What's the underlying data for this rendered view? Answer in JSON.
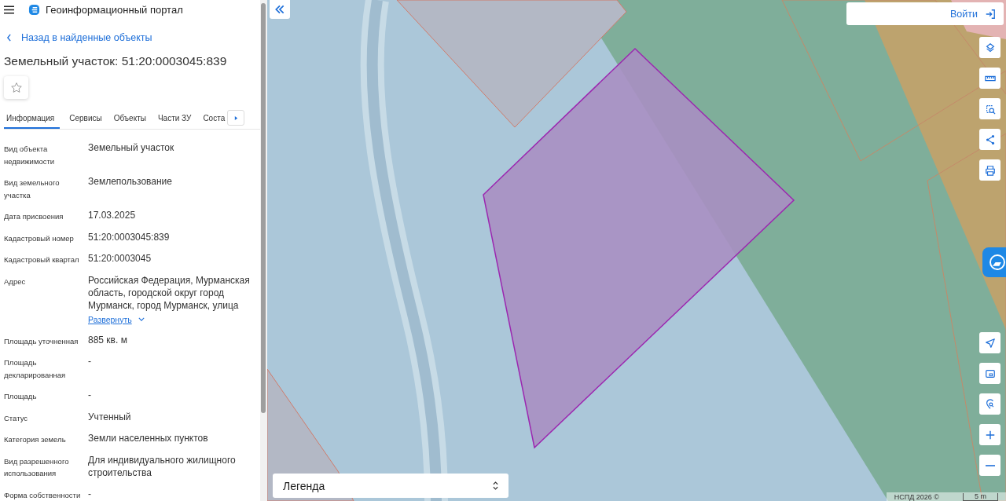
{
  "header": {
    "title": "Геоинформационный портал"
  },
  "back_link": "Назад в найденные объекты",
  "title": "Земельный участок: 51:20:0003045:839",
  "favorite": {
    "selected": false
  },
  "tabs": [
    {
      "label": "Информация",
      "selected": true
    },
    {
      "label": "Сервисы",
      "selected": false
    },
    {
      "label": "Объекты",
      "selected": false
    },
    {
      "label": "Части ЗУ",
      "selected": false
    },
    {
      "label": "Соста",
      "selected": false
    }
  ],
  "fields": [
    {
      "label": "Вид объекта недвижимости",
      "value": "Земельный участок"
    },
    {
      "label": "Вид земельного участка",
      "value": "Землепользование"
    },
    {
      "label": "Дата присвоения",
      "value": "17.03.2025"
    },
    {
      "label": "Кадастровый номер",
      "value": "51:20:0003045:839"
    },
    {
      "label": "Кадастровый квартал",
      "value": "51:20:0003045"
    },
    {
      "label": "Адрес",
      "value": "Российская Федерация, Мурманская область, городской округ город Мурманск, город Мурманск, улица",
      "expand_link": "Развернуть"
    },
    {
      "label": "Площадь уточненная",
      "value": "885 кв. м"
    },
    {
      "label": "Площадь декларированная",
      "value": "-"
    },
    {
      "label": "Площадь",
      "value": "-"
    },
    {
      "label": "Статус",
      "value": "Учтенный"
    },
    {
      "label": "Категория земель",
      "value": "Земли населенных пунктов"
    },
    {
      "label": "Вид разрешенного использования",
      "value": "Для индивидуального жилищного строительства"
    },
    {
      "label": "Форма собственности",
      "value": "-"
    }
  ],
  "map": {
    "login_label": "Войти",
    "legend_label": "Легенда",
    "attribution": "НСПД 2026 ©",
    "scale_label": "5 m"
  }
}
